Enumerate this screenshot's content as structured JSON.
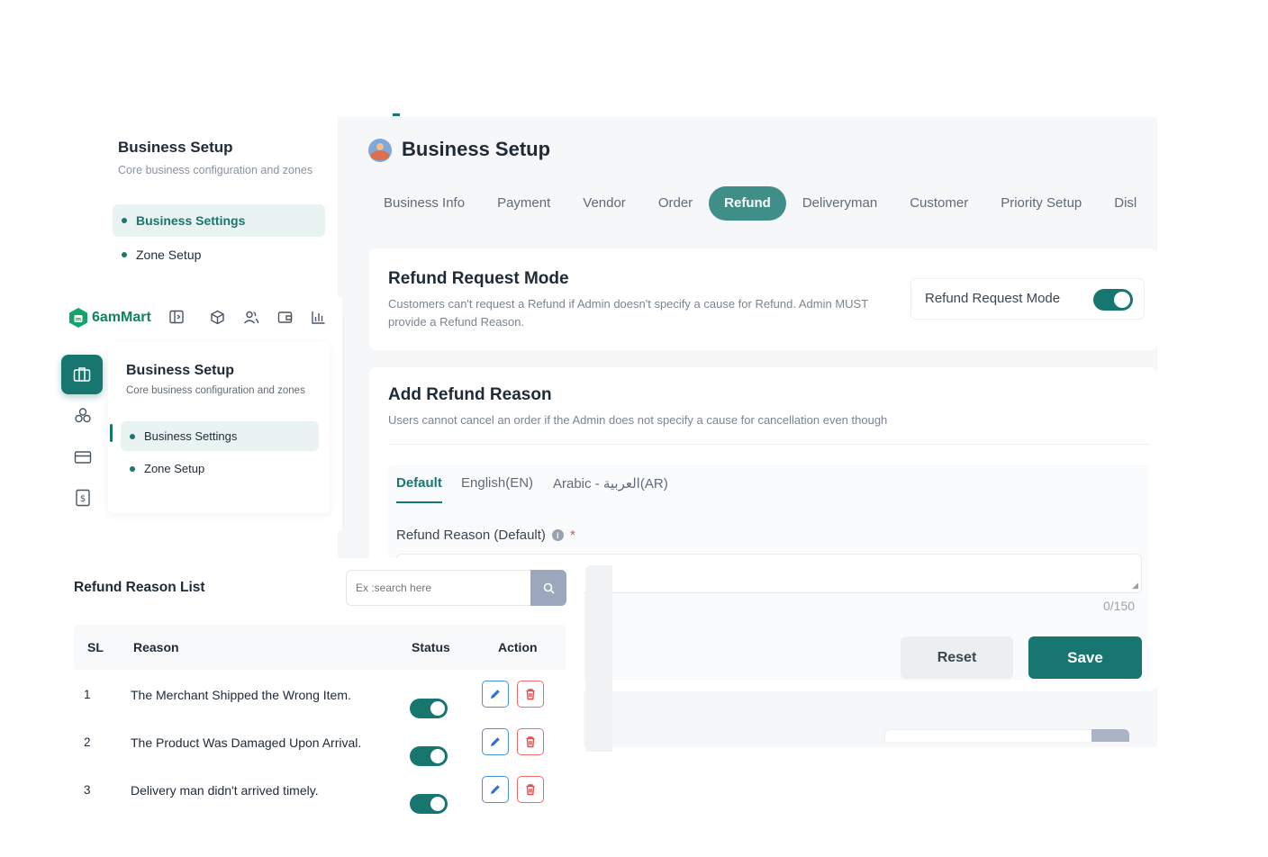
{
  "back_sidebar": {
    "title": "Business Setup",
    "subtitle": "Core business configuration and zones",
    "items": [
      {
        "label": "Business Settings",
        "active": true
      },
      {
        "label": "Zone Setup",
        "active": false
      }
    ]
  },
  "page": {
    "title": "Business Setup",
    "tabs": [
      {
        "label": "Business Info"
      },
      {
        "label": "Payment"
      },
      {
        "label": "Vendor"
      },
      {
        "label": "Order"
      },
      {
        "label": "Refund",
        "active": true
      },
      {
        "label": "Deliveryman"
      },
      {
        "label": "Customer"
      },
      {
        "label": "Priority Setup"
      },
      {
        "label": "Disl"
      }
    ]
  },
  "refund_mode": {
    "title": "Refund Request Mode",
    "description": "Customers can't request a Refund if Admin doesn't specify a cause for Refund. Admin MUST provide a Refund Reason.",
    "toggle_label": "Refund Request Mode",
    "toggle_on": true
  },
  "add_reason": {
    "title": "Add Refund Reason",
    "description": "Users cannot cancel an order if the Admin does not specify a cause for cancellation even though",
    "lang_tabs": [
      {
        "label": "Default",
        "active": true
      },
      {
        "label": "English(EN)"
      },
      {
        "label": "Arabic - العربية(AR)"
      }
    ],
    "field_label": "Refund Reason (Default)",
    "required_mark": "*",
    "value": "",
    "counter": "0/150",
    "reset_label": "Reset",
    "save_label": "Save"
  },
  "front": {
    "brand": "6amMart",
    "title": "Business Setup",
    "subtitle": "Core business configuration and zones",
    "items": [
      {
        "label": "Business Settings",
        "active": true
      },
      {
        "label": "Zone Setup",
        "active": false
      }
    ],
    "top_icons": [
      "sidebar-toggle-icon",
      "box-icon",
      "users-icon",
      "wallet-icon",
      "chart-icon"
    ],
    "rail_icons": [
      "business-icon",
      "modules-icon",
      "card-icon",
      "bill-icon"
    ]
  },
  "list": {
    "title": "Refund Reason List",
    "search_placeholder": "Ex :search here",
    "columns": [
      "SL",
      "Reason",
      "Status",
      "Action"
    ],
    "rows": [
      {
        "sl": "1",
        "reason": "The Merchant Shipped the Wrong Item.",
        "status": true
      },
      {
        "sl": "2",
        "reason": "The Product Was Damaged Upon Arrival.",
        "status": true
      },
      {
        "sl": "3",
        "reason": "Delivery man didn't arrived timely.",
        "status": true
      }
    ]
  },
  "colors": {
    "primary": "#17766f",
    "tab_active": "#3f8f88",
    "danger": "#ef6b6b",
    "edit": "#4a90e2"
  }
}
